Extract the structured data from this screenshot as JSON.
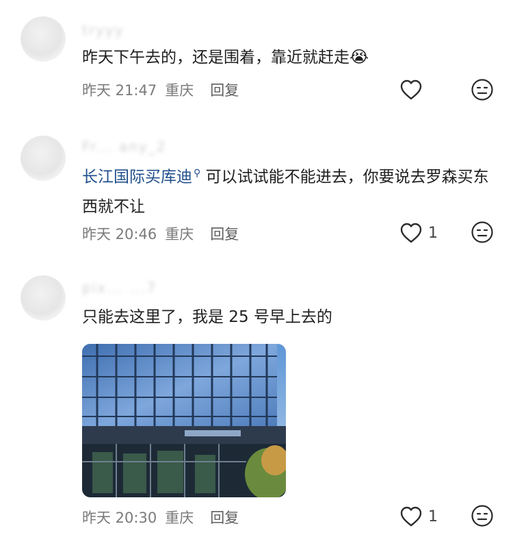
{
  "comments": [
    {
      "username": "tryyy",
      "text": "昨天下午去的，还是围着，靠近就赶走",
      "emoji": "😭",
      "time": "昨天 21:47",
      "location": "重庆",
      "reply_label": "回复",
      "likes": ""
    },
    {
      "username": "Fr... any_2",
      "mention": "长江国际买库迪",
      "text": " 可以试试能不能进去，你要说去罗森买东西就不让",
      "time": "昨天 20:46",
      "location": "重庆",
      "reply_label": "回复",
      "likes": "1"
    },
    {
      "username": "pix... ...7",
      "text": "只能去这里了，我是 25 号早上去的",
      "time": "昨天 20:30",
      "location": "重庆",
      "reply_label": "回复",
      "likes": "1",
      "photo_alt": "长江国际大楼玻璃幕墙"
    }
  ],
  "icons": {
    "like": "heart-outline-icon",
    "emoji_react": "neutral-face-icon",
    "mention": "search-icon"
  },
  "colors": {
    "mention": "#1f4e8c",
    "meta": "#7a7a7a",
    "text": "#1f1f1f"
  }
}
